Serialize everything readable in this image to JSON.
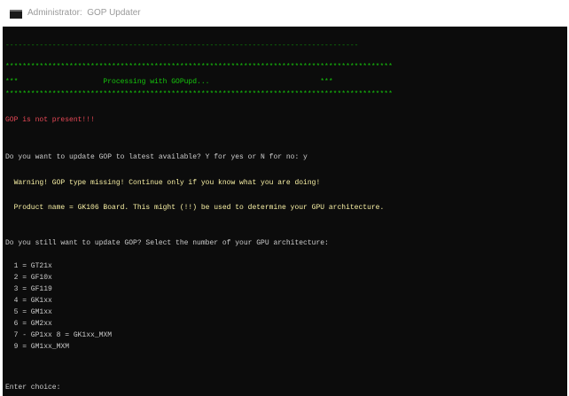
{
  "window": {
    "title": "Administrator:  GOP Updater",
    "icon": "console-icon"
  },
  "console": {
    "rule_top": "-----------------------------------------------------------------------------------",
    "banner_stars_top": "*******************************************************************************************",
    "banner_text": "***                    Processing with GOPupd...                          ***",
    "banner_stars_bottom": "*******************************************************************************************",
    "error": "GOP is not present!!!",
    "question1": "Do you want to update GOP to latest available? Y for yes or N for no: y",
    "warning": "  Warning! GOP type missing! Continue only if you know what you are doing!",
    "product": "  Product name = GK106 Board. This might (!!) be used to determine your GPU architecture.",
    "question2": "Do you still want to update GOP? Select the number of your GPU architecture:",
    "options": [
      "  1 = GT21x",
      "  2 = GF10x",
      "  3 = GF119",
      "  4 = GK1xx",
      "  5 = GM1xx",
      "  6 = GM2xx",
      "  7 - GP1xx 8 = GK1xx_MXM",
      "  9 = GM1xx_MXM"
    ],
    "prompt": "Enter choice:"
  },
  "colors": {
    "console_bg": "#0c0c0c",
    "green": "#16c60c",
    "red": "#e74856",
    "white": "#cccccc",
    "yellow": "#f9f1a5"
  }
}
